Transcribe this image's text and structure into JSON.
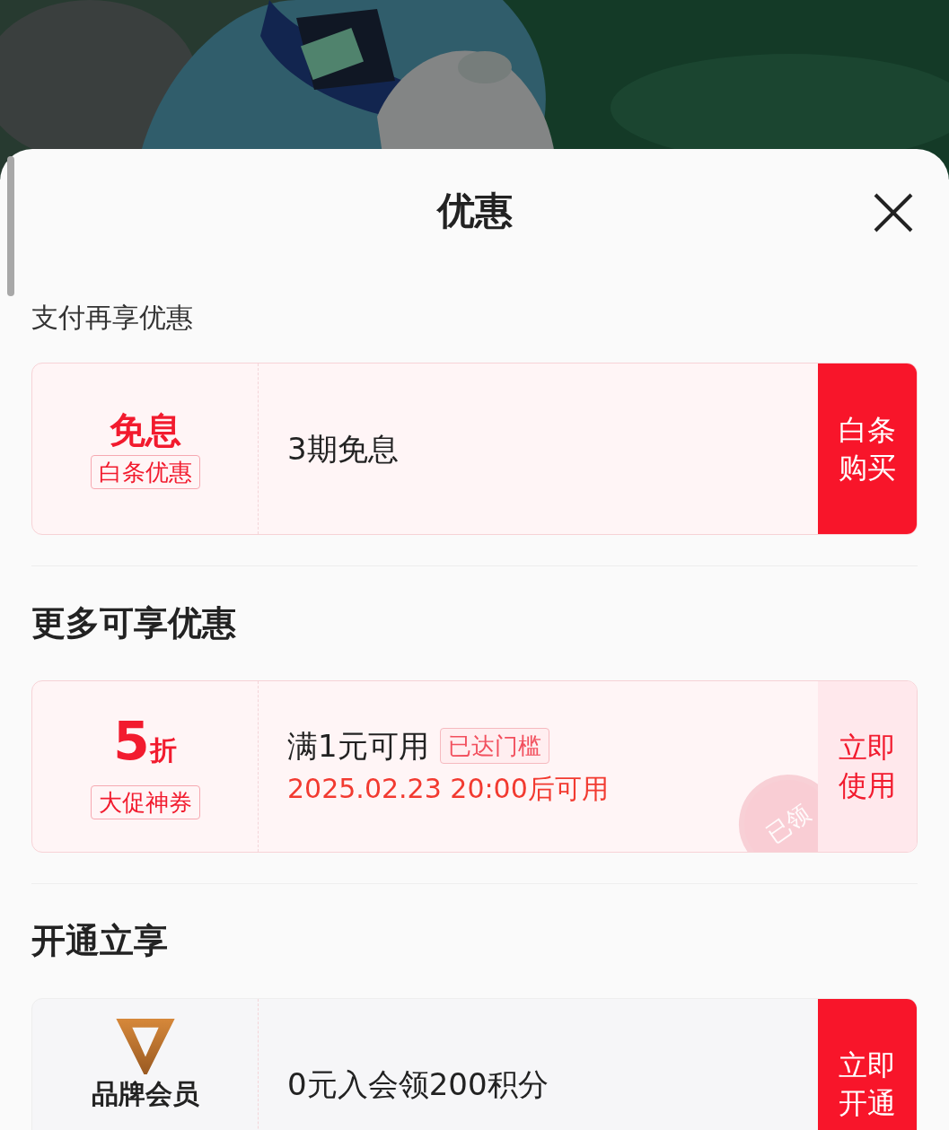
{
  "sheet": {
    "title": "优惠"
  },
  "sections": [
    {
      "heading": "支付再享优惠",
      "bold": false,
      "offers": [
        {
          "kind": "payment",
          "value": "免息",
          "tag": "白条优惠",
          "description": "3期免息",
          "action_lines": [
            "白条",
            "购买"
          ]
        }
      ]
    },
    {
      "heading": "更多可享优惠",
      "bold": true,
      "offers": [
        {
          "kind": "coupon",
          "value": "5",
          "unit": "折",
          "tag": "大促神券",
          "description": "满1元可用",
          "badge": "已达门槛",
          "note": "2025.02.23 20:00后可用",
          "stamp": "已领",
          "action_lines": [
            "立即",
            "使用"
          ]
        }
      ]
    },
    {
      "heading": "开通立享",
      "bold": true,
      "offers": [
        {
          "kind": "membership",
          "tag": "品牌会员",
          "description": "0元入会领200积分",
          "action_lines": [
            "立即",
            "开通"
          ]
        }
      ]
    }
  ]
}
